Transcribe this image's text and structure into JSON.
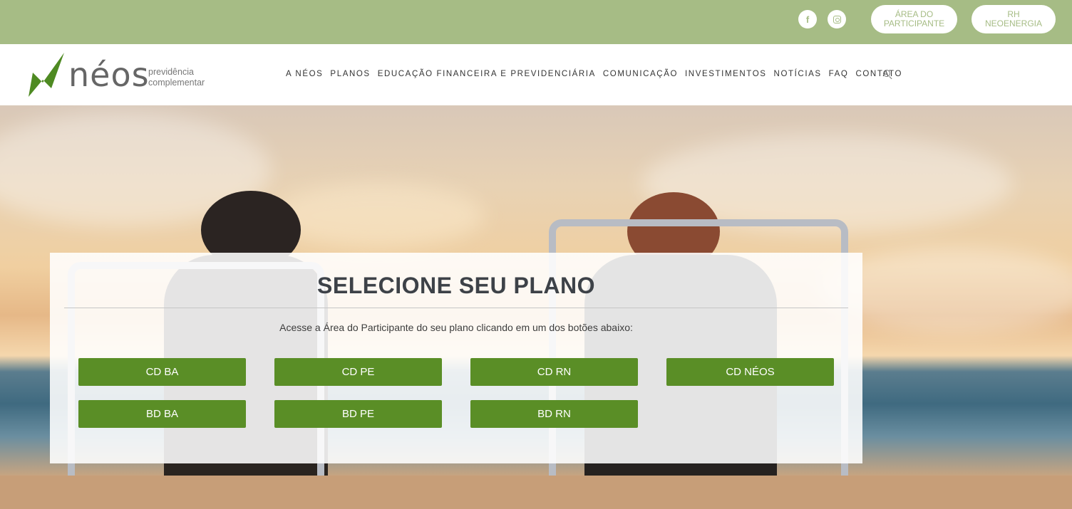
{
  "topbar": {
    "social": [
      {
        "icon": "facebook-icon",
        "glyph": "f"
      },
      {
        "icon": "instagram-icon"
      }
    ],
    "area_participante": "ÁREA DO\nPARTICIPANTE",
    "rh_neoenergia": "RH\nNEOENERGIA"
  },
  "logo": {
    "wordmark": "néos",
    "sub_line1": "previdência",
    "sub_line2": "complementar"
  },
  "nav": {
    "items": [
      "A NÉOS",
      "PLANOS",
      "EDUCAÇÃO FINANCEIRA E PREVIDENCIÁRIA",
      "COMUNICAÇÃO",
      "INVESTIMENTOS",
      "NOTÍCIAS",
      "FAQ",
      "CONTATO"
    ]
  },
  "panel": {
    "title": "SELECIONE SEU PLANO",
    "subtitle": "Acesse a Área do Participante do seu plano clicando em um dos botões abaixo:",
    "plans": [
      "CD BA",
      "CD PE",
      "CD RN",
      "CD NÉOS",
      "BD BA",
      "BD PE",
      "BD RN"
    ]
  },
  "colors": {
    "topbar": "#a6bc85",
    "button": "#5a8e26",
    "logo_green": "#4e8a22"
  }
}
